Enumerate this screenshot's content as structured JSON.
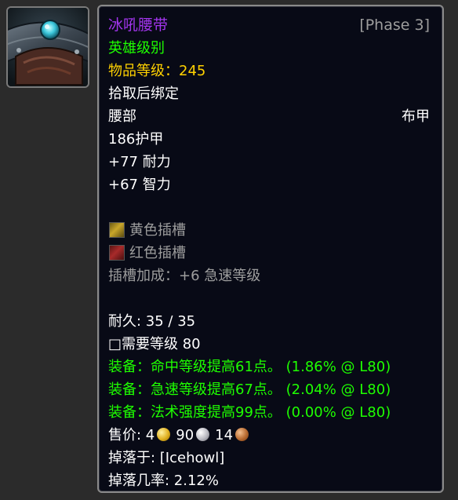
{
  "item": {
    "icon_name": "mail-belt-icon",
    "name": "冰吼腰带",
    "phase": "[Phase 3]",
    "quality": "英雄级别",
    "ilvl_label": "物品等级：",
    "ilvl_value": "245",
    "binding": "拾取后绑定",
    "slot": "腰部",
    "armor_type": "布甲",
    "armor": "186护甲",
    "stats": [
      "+77 耐力",
      "+67 智力"
    ],
    "sockets": [
      {
        "label": "黄色插槽",
        "color": "#c9a62a"
      },
      {
        "label": "红色插槽",
        "color": "#a82a2a"
      }
    ],
    "socket_bonus": "插槽加成：+6 急速等级",
    "durability": "耐久: 35 / 35",
    "required_level": "□需要等级 80",
    "equip_effects": [
      "装备：命中等级提高61点。 (1.86% @ L80)",
      "装备：急速等级提高67点。 (2.04% @ L80)",
      "装备：法术强度提高99点。 (0.00% @ L80)"
    ],
    "sell_price": {
      "label": "售价: ",
      "gold": "4",
      "silver": "90",
      "copper": "14"
    },
    "dropped_by": "掉落于: [Icehowl]",
    "drop_rate": "掉落几率: 2.12%"
  },
  "colors": {
    "epic": "#a335ee",
    "heroic": "#1eff00",
    "ilvl": "#ffd100",
    "grey": "#9d9d9d",
    "background": "#080a16"
  }
}
